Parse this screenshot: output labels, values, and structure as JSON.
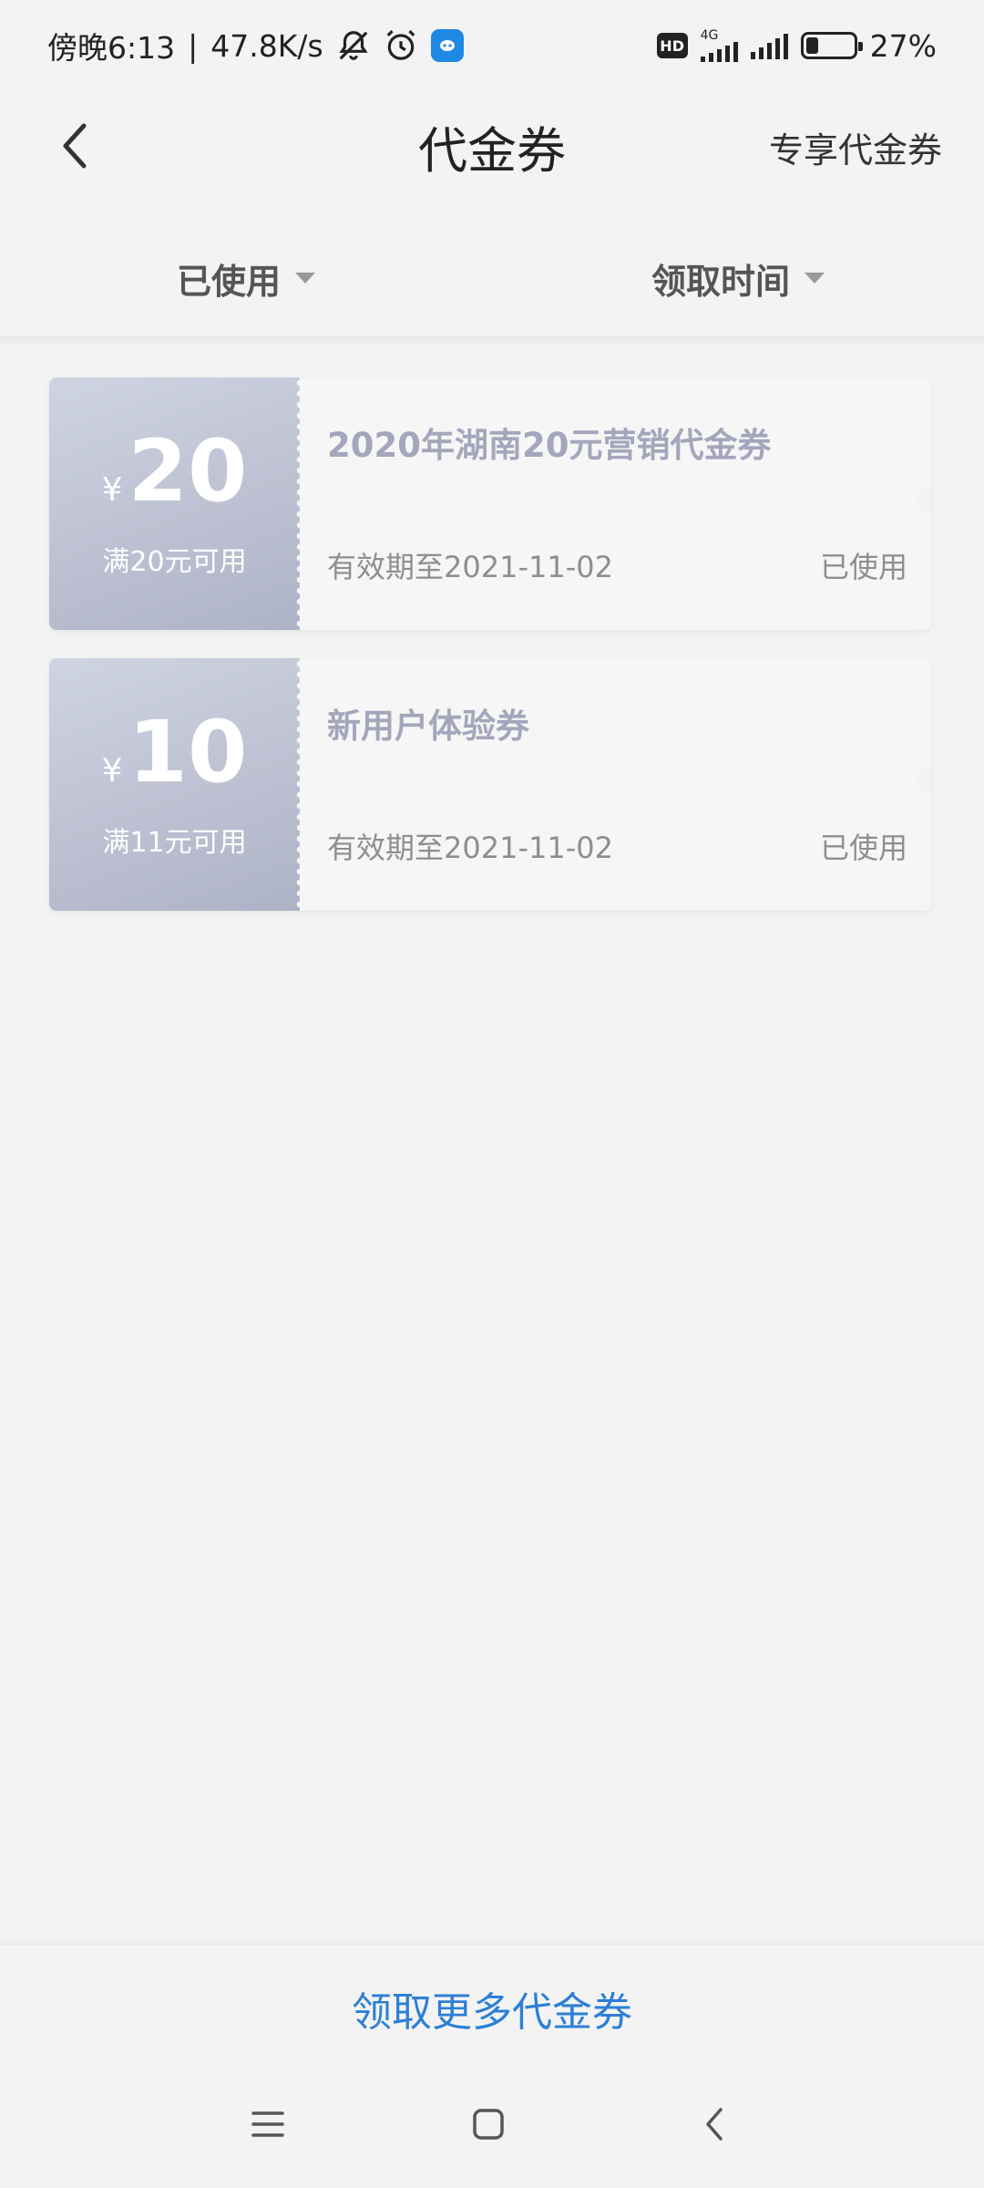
{
  "status_bar": {
    "time": "傍晚6:13",
    "speed": "47.8K/s",
    "network_label": "4G",
    "hd_label": "HD",
    "battery_percent": "27%",
    "battery_level": 0.27,
    "icons": [
      "mute-icon",
      "alarm-icon",
      "app-notification-icon",
      "hd-icon",
      "signal-icon",
      "battery-icon"
    ]
  },
  "nav": {
    "title": "代金券",
    "right_link": "专享代金券",
    "back_icon": "chevron-left-icon"
  },
  "filters": [
    {
      "label": "已使用"
    },
    {
      "label": "领取时间"
    }
  ],
  "coupons": [
    {
      "currency": "¥",
      "amount": "20",
      "threshold": "满20元可用",
      "name": "2020年湖南20元营销代金券",
      "validity": "有效期至2021-11-02",
      "status": "已使用"
    },
    {
      "currency": "¥",
      "amount": "10",
      "threshold": "满11元可用",
      "name": "新用户体验券",
      "validity": "有效期至2021-11-02",
      "status": "已使用"
    }
  ],
  "bottom": {
    "more_link": "领取更多代金券"
  },
  "colors": {
    "accent": "#2d7fd6",
    "coupon_gradient_start": "#cfd4e2",
    "coupon_gradient_end": "#aeb2c6",
    "coupon_name": "#a4a6bc"
  },
  "system_nav": [
    "menu-icon",
    "home-icon",
    "back-icon"
  ]
}
